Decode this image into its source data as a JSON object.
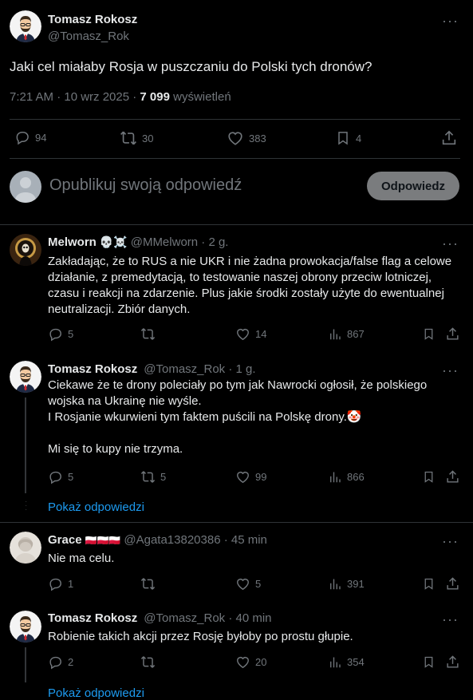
{
  "main_post": {
    "author_name": "Tomasz Rokosz",
    "author_handle": "@Tomasz_Rok",
    "text": "Jaki cel miałaby Rosja w puszczaniu do Polski tych dronów?",
    "time": "7:21 AM · 10 wrz 2025 · ",
    "views_count": "7 099",
    "views_label": " wyświetleń",
    "stats": {
      "replies": "94",
      "reposts": "30",
      "likes": "383",
      "bookmarks": "4"
    }
  },
  "compose": {
    "placeholder": "Opublikuj swoją odpowiedź",
    "button": "Odpowiedz"
  },
  "replies": [
    {
      "name": "Melworn",
      "emoji": "💀☠️",
      "handle": "@MMelworn · 2 g.",
      "text": "Zakładając, że to RUS a nie UKR i nie żadna prowokacja/false flag a celowe działanie, z premedytacją, to testowanie naszej obrony przeciw lotniczej, czasu i reakcji na zdarzenie. Plus jakie środki zostały użyte do ewentualnej neutralizacji. Zbiór danych.",
      "replies": "5",
      "reposts": "",
      "likes": "14",
      "views": "867"
    },
    {
      "name": "Tomasz Rokosz",
      "emoji": "",
      "handle": "@Tomasz_Rok · 1 g.",
      "text": "Ciekawe że te drony poleciały po tym jak Nawrocki ogłosił, że polskiego wojska na Ukrainę nie wyśle.\nI Rosjanie wkurwieni tym faktem puścili na Polskę drony.🤡\n\nMi się to kupy nie trzyma.",
      "replies": "5",
      "reposts": "5",
      "likes": "99",
      "views": "866",
      "show_replies": "Pokaż odpowiedzi"
    },
    {
      "name": "Grace",
      "emoji": "🇵🇱🇵🇱🇵🇱",
      "handle": "@Agata13820386 · 45 min",
      "text": "Nie ma celu.",
      "replies": "1",
      "reposts": "",
      "likes": "5",
      "views": "391"
    },
    {
      "name": "Tomasz Rokosz",
      "emoji": "",
      "handle": "@Tomasz_Rok · 40 min",
      "text": "Robienie takich akcji przez Rosję byłoby po prostu głupie.",
      "replies": "2",
      "reposts": "",
      "likes": "20",
      "views": "354",
      "show_replies": "Pokaż odpowiedzi"
    }
  ],
  "icons": {
    "reply": "reply-icon",
    "repost": "repost-icon",
    "like": "like-icon",
    "views": "views-icon",
    "bookmark": "bookmark-icon",
    "share": "share-icon",
    "more": "more-icon"
  },
  "colors": {
    "background": "#000000",
    "text": "#e7e9ea",
    "secondary": "#71767b",
    "link": "#1d9bf0",
    "border": "#2f3336"
  }
}
